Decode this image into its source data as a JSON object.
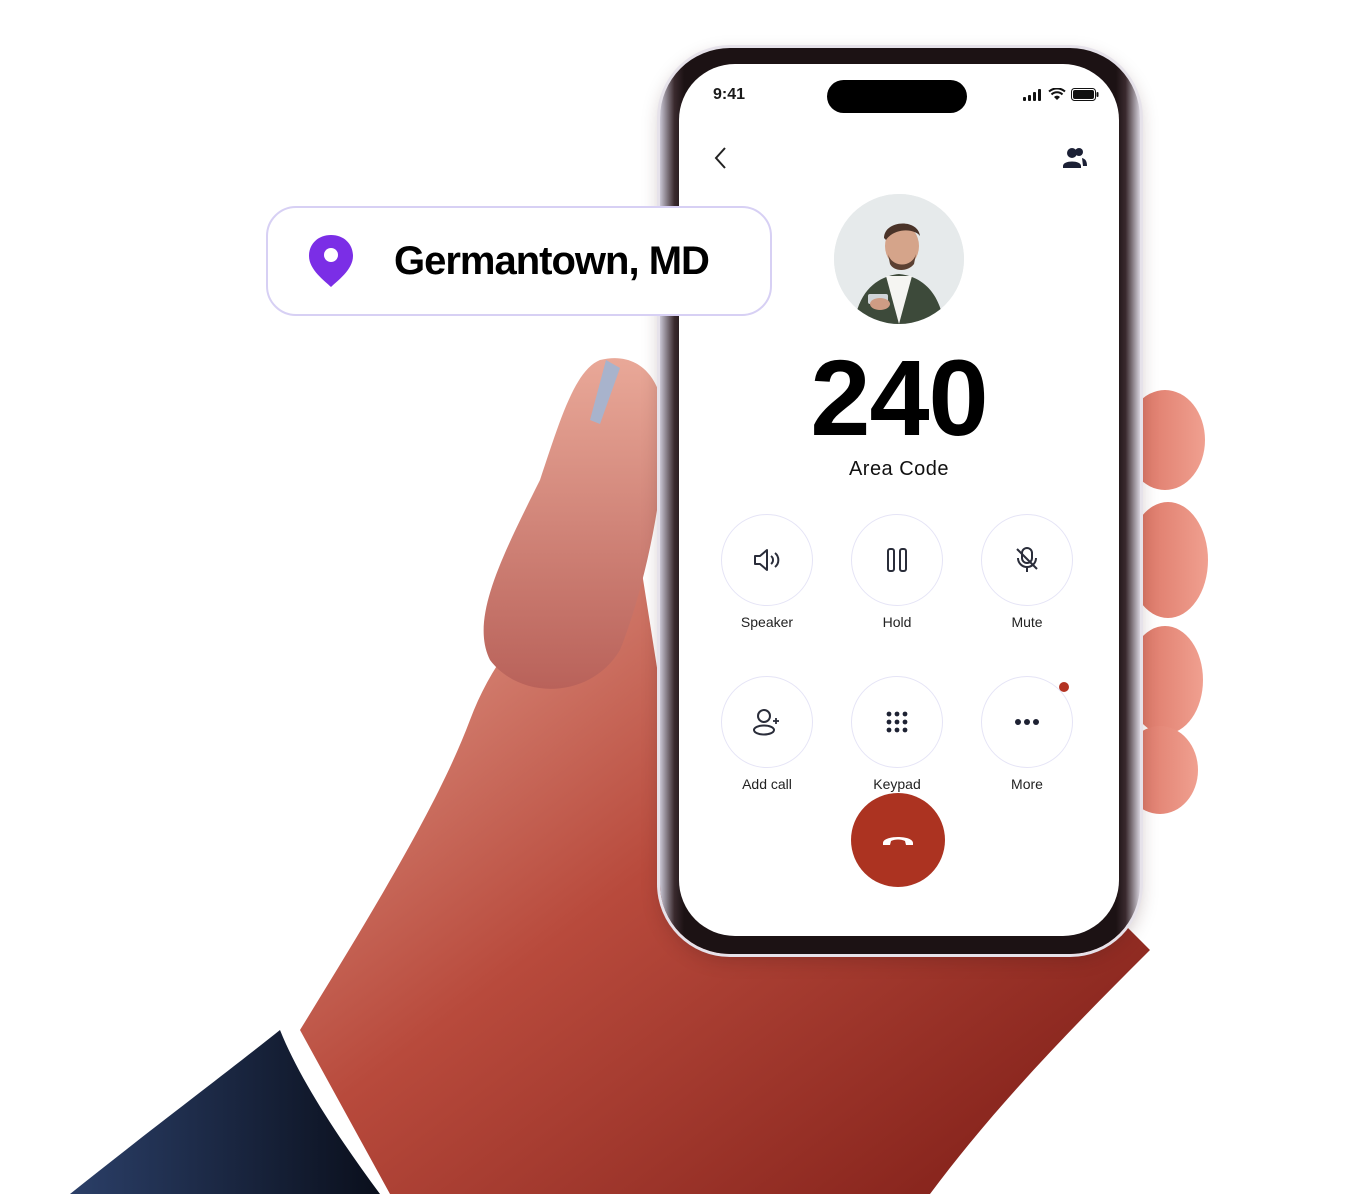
{
  "status_bar": {
    "time": "9:41"
  },
  "header": {
    "back_icon": "chevron-left-icon",
    "contacts_icon": "contacts-icon"
  },
  "caller": {
    "avatar_alt": "Caller photo",
    "area_code": "240",
    "area_label": "Area Code"
  },
  "controls": [
    {
      "label": "Speaker",
      "icon": "speaker-icon"
    },
    {
      "label": "Hold",
      "icon": "pause-icon"
    },
    {
      "label": "Mute",
      "icon": "mic-off-icon"
    },
    {
      "label": "Add call",
      "icon": "add-person-icon"
    },
    {
      "label": "Keypad",
      "icon": "keypad-icon"
    },
    {
      "label": "More",
      "icon": "more-dots-icon",
      "badge": true
    }
  ],
  "end_call": {
    "icon": "hang-up-icon"
  },
  "location": {
    "text": "Germantown, MD",
    "icon": "map-pin-icon"
  },
  "colors": {
    "end_call": "#ac3321",
    "pin": "#7b2ee6",
    "badge": "#b33322",
    "pill_border": "#d7d0f4"
  }
}
